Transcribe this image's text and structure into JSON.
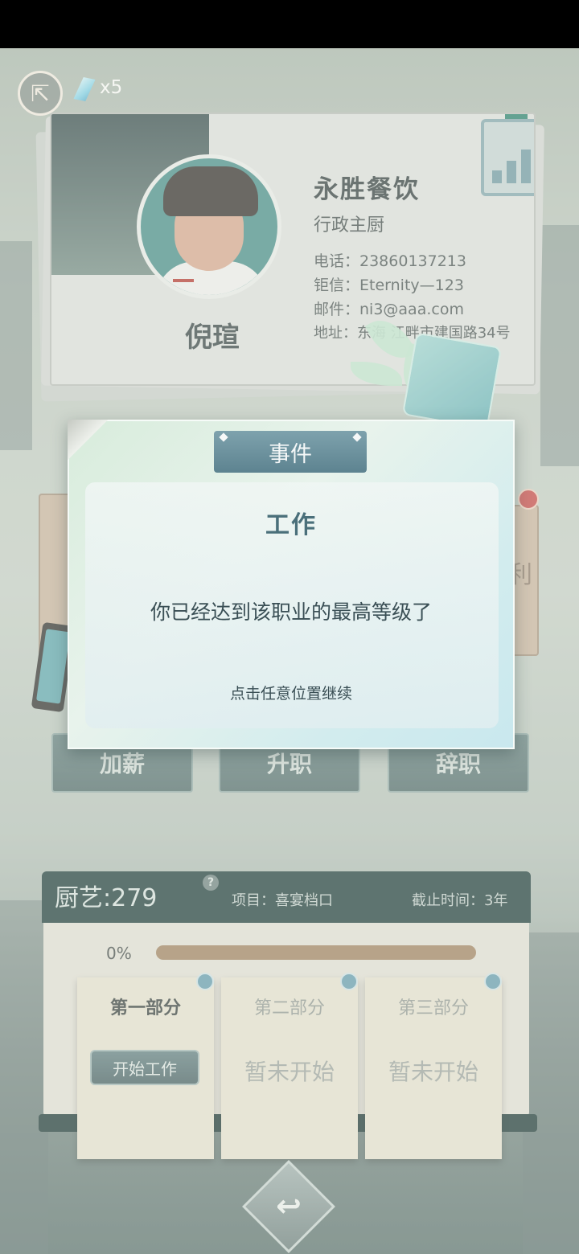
{
  "top_bar": {
    "gem_count": "x5"
  },
  "card": {
    "person_name": "倪瑄",
    "company": "永胜餐饮",
    "job_title": "行政主厨",
    "phone": "电话：23860137213",
    "message_id": "钜信：Eternity—123",
    "email": "邮件：ni3@aaa.com",
    "address": "地址：东海 江畔市建国路34号"
  },
  "background_panel_right_char": "利",
  "actions": {
    "raise": "加薪",
    "promote": "升职",
    "resign": "辞职"
  },
  "work": {
    "skill": "厨艺:279",
    "help": "?",
    "project": "项目：喜宴档口",
    "deadline": "截止时间：3年",
    "progress_label": "0%",
    "progress_value": 0,
    "parts": [
      {
        "title": "第一部分",
        "action": "开始工作"
      },
      {
        "title": "第二部分",
        "status": "暂未开始"
      },
      {
        "title": "第三部分",
        "status": "暂未开始"
      }
    ]
  },
  "dialog": {
    "tab": "事件",
    "heading": "工作",
    "message": "你已经达到该职业的最高等级了",
    "hint": "点击任意位置继续"
  },
  "colors": {
    "dialog_tab": "#6f95a0",
    "header_dark": "#163636",
    "progress_track": "#9e7f5d"
  }
}
